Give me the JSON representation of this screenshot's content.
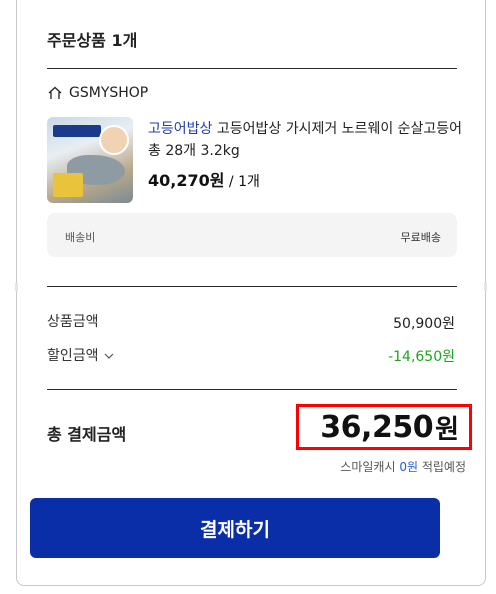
{
  "order": {
    "title": "주문상품 1개"
  },
  "shop": {
    "name": "GSMYSHOP",
    "icon": "home-icon"
  },
  "product": {
    "brand": "고등어밥상",
    "name": "고등어밥상 가시제거 노르웨이 순살고등어 총 28개 3.2kg",
    "price": "40,270원",
    "qty": "/ 1개",
    "image": "product-thumbnail"
  },
  "shipping": {
    "label": "배송비",
    "value": "무료배송"
  },
  "summary": {
    "product_amount_label": "상품금액",
    "product_amount": "50,900원",
    "discount_label": "할인금액",
    "discount_amount": "-14,650원"
  },
  "total": {
    "label": "총 결제금액",
    "amount": "36,250",
    "unit": "원"
  },
  "smile_cash": {
    "prefix": "스마일캐시",
    "amount": "0원",
    "suffix": "적립예정"
  },
  "pay_button": {
    "label": "결제하기"
  },
  "colors": {
    "primary": "#0a2ea8",
    "discount": "#19a719",
    "highlight": "#ff0000",
    "brand_link": "#1f3fae"
  }
}
